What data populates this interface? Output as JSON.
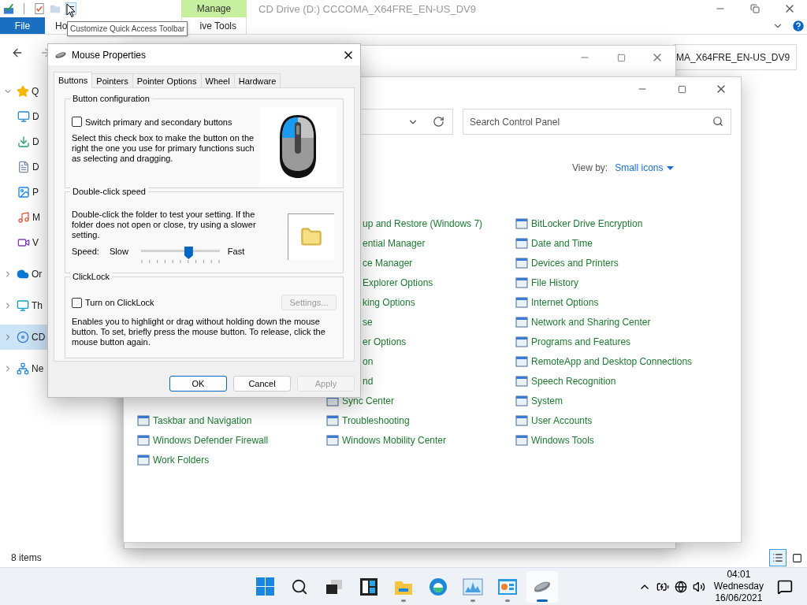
{
  "explorer": {
    "title": "CD Drive (D:) CCCOMA_X64FRE_EN-US_DV9",
    "context_header": "Manage",
    "tooltip": "Customize Quick Access Toolbar",
    "ribbon_tabs": [
      {
        "label": "File",
        "kind": "file"
      },
      {
        "label": "Ho",
        "kind": "tab"
      },
      {
        "label": "ive Tools",
        "kind": "context"
      }
    ],
    "address": "MA_X64FRE_EN-US_DV9",
    "sidebar": [
      {
        "label": "Q",
        "kind": "star",
        "expanded": true,
        "selected": false,
        "children": [
          {
            "label": "D",
            "kind": "desktop",
            "selected": false
          },
          {
            "label": "D",
            "kind": "download",
            "selected": false
          },
          {
            "label": "D",
            "kind": "document",
            "selected": false
          },
          {
            "label": "P",
            "kind": "pictures",
            "selected": false
          },
          {
            "label": "M",
            "kind": "music",
            "selected": false
          },
          {
            "label": "V",
            "kind": "videos",
            "selected": false
          }
        ]
      },
      {
        "label": "Or",
        "kind": "cloud",
        "expanded": false,
        "selected": false
      },
      {
        "label": "Th",
        "kind": "pc",
        "expanded": false,
        "selected": false
      },
      {
        "label": "CD",
        "kind": "drive",
        "expanded": false,
        "selected": true
      },
      {
        "label": "Ne",
        "kind": "network",
        "expanded": false,
        "selected": false
      }
    ],
    "status": "8 items",
    "view_buttons": [
      {
        "kind": "details",
        "selected": true
      },
      {
        "kind": "tiles",
        "selected": false
      }
    ]
  },
  "control_panel": {
    "search_placeholder": "Search Control Panel",
    "view_by_label": "View by:",
    "view_by": "Small icons",
    "columns": [
      [
        {
          "label": "Taskbar and Navigation",
          "kind": "full"
        },
        {
          "label": "Windows Defender Firewall",
          "kind": "full"
        },
        {
          "label": "Work Folders",
          "kind": "full"
        }
      ],
      [
        {
          "label": "up and Restore (Windows 7)",
          "kind": "partial"
        },
        {
          "label": "ential Manager",
          "kind": "partial"
        },
        {
          "label": "ce Manager",
          "kind": "partial"
        },
        {
          "label": "Explorer Options",
          "kind": "partial"
        },
        {
          "label": "king Options",
          "kind": "partial"
        },
        {
          "label": "se",
          "kind": "partial"
        },
        {
          "label": "er Options",
          "kind": "partial"
        },
        {
          "label": "on",
          "kind": "partial"
        },
        {
          "label": "nd",
          "kind": "partial"
        },
        {
          "label": "Sync Center",
          "kind": "full"
        },
        {
          "label": "Troubleshooting",
          "kind": "full"
        },
        {
          "label": "Windows Mobility Center",
          "kind": "full"
        }
      ],
      [
        {
          "label": "BitLocker Drive Encryption",
          "kind": "full"
        },
        {
          "label": "Date and Time",
          "kind": "full"
        },
        {
          "label": "Devices and Printers",
          "kind": "full"
        },
        {
          "label": "File History",
          "kind": "full"
        },
        {
          "label": "Internet Options",
          "kind": "full"
        },
        {
          "label": "Network and Sharing Center",
          "kind": "full"
        },
        {
          "label": "Programs and Features",
          "kind": "full"
        },
        {
          "label": "RemoteApp and Desktop Connections",
          "kind": "full"
        },
        {
          "label": "Speech Recognition",
          "kind": "full"
        },
        {
          "label": "System",
          "kind": "full"
        },
        {
          "label": "User Accounts",
          "kind": "full"
        },
        {
          "label": "Windows Tools",
          "kind": "full"
        }
      ]
    ]
  },
  "dialog": {
    "title": "Mouse Properties",
    "tabs": [
      {
        "label": "Buttons",
        "selected": true
      },
      {
        "label": "Pointers",
        "selected": false
      },
      {
        "label": "Pointer Options",
        "selected": false
      },
      {
        "label": "Wheel",
        "selected": false
      },
      {
        "label": "Hardware",
        "selected": false
      }
    ],
    "button_config": {
      "title": "Button configuration",
      "checkbox": {
        "label": "Switch primary and secondary buttons",
        "checked": false
      },
      "description": "Select this check box to make the button on the right the one you use for primary functions such as selecting and dragging."
    },
    "double_click": {
      "title": "Double-click speed",
      "description": "Double-click the folder to test your setting. If the folder does not open or close, try using a slower setting.",
      "speed_label": "Speed:",
      "slow": "Slow",
      "fast": "Fast",
      "level": 0.6
    },
    "clicklock": {
      "title": "ClickLock",
      "checkbox": {
        "label": "Turn on ClickLock",
        "checked": false
      },
      "settings": {
        "label": "Settings...",
        "disabled": true
      },
      "description": "Enables you to highlight or drag without holding down the mouse button. To set, briefly press the mouse button. To release, click the mouse button again."
    },
    "buttons": [
      {
        "label": "OK",
        "kind": "default",
        "disabled": false
      },
      {
        "label": "Cancel",
        "kind": "normal",
        "disabled": false
      },
      {
        "label": "Apply",
        "kind": "normal",
        "disabled": true
      }
    ]
  },
  "taskbar": {
    "apps": [
      {
        "kind": "start",
        "running": false,
        "selected": false
      },
      {
        "kind": "search",
        "running": false,
        "selected": false
      },
      {
        "kind": "taskview",
        "running": false,
        "selected": false
      },
      {
        "kind": "widgets",
        "running": false,
        "selected": false
      },
      {
        "kind": "explorer",
        "running": true,
        "selected": false
      },
      {
        "kind": "edge",
        "running": false,
        "selected": false
      },
      {
        "kind": "perfmon",
        "running": true,
        "selected": false
      },
      {
        "kind": "controlpanel",
        "running": true,
        "selected": false
      },
      {
        "kind": "mouse",
        "running": true,
        "selected": true
      }
    ],
    "time": "04:01",
    "day": "Wednesday",
    "date": "16/06/2021"
  }
}
